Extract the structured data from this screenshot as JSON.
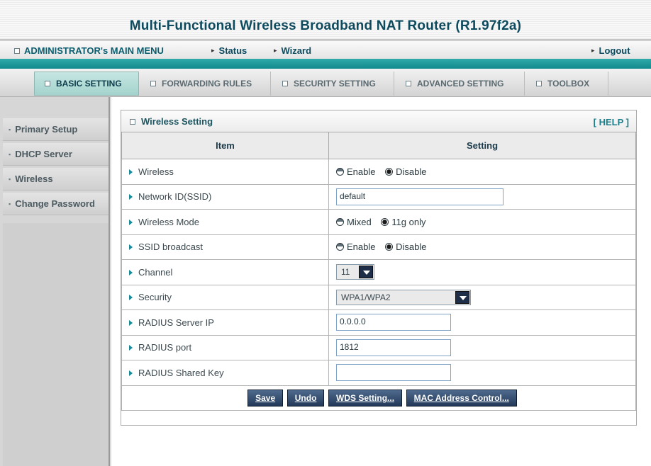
{
  "title": "Multi-Functional Wireless Broadband NAT Router (R1.97f2a)",
  "menu": {
    "admin": "ADMINISTRATOR's MAIN MENU",
    "status": "Status",
    "wizard": "Wizard",
    "logout": "Logout"
  },
  "tabs": [
    {
      "label": "BASIC SETTING"
    },
    {
      "label": "FORWARDING RULES"
    },
    {
      "label": "SECURITY SETTING"
    },
    {
      "label": "ADVANCED SETTING"
    },
    {
      "label": "TOOLBOX"
    }
  ],
  "sidebar": {
    "items": [
      {
        "label": "Primary Setup"
      },
      {
        "label": "DHCP Server"
      },
      {
        "label": "Wireless"
      },
      {
        "label": "Change Password"
      }
    ]
  },
  "panel": {
    "title": "Wireless Setting",
    "help": "[ HELP ]",
    "col_item": "Item",
    "col_setting": "Setting"
  },
  "rows": {
    "wireless": {
      "label": "Wireless",
      "opt1": "Enable",
      "opt2": "Disable"
    },
    "ssid": {
      "label": "Network ID(SSID)",
      "value": "default"
    },
    "mode": {
      "label": "Wireless Mode",
      "opt1": "Mixed",
      "opt2": "11g only"
    },
    "broadcast": {
      "label": "SSID broadcast",
      "opt1": "Enable",
      "opt2": "Disable"
    },
    "channel": {
      "label": "Channel",
      "value": "11"
    },
    "security": {
      "label": "Security",
      "value": "WPA1/WPA2"
    },
    "radius_ip": {
      "label": "RADIUS Server IP",
      "value": "0.0.0.0"
    },
    "radius_port": {
      "label": "RADIUS port",
      "value": "1812"
    },
    "radius_key": {
      "label": "RADIUS Shared Key",
      "value": ""
    }
  },
  "buttons": {
    "save": "Save",
    "undo": "Undo",
    "wds": "WDS Setting...",
    "mac": "MAC Address Control..."
  },
  "colors": {
    "accent": "#128a8e",
    "button": "#23395a"
  }
}
